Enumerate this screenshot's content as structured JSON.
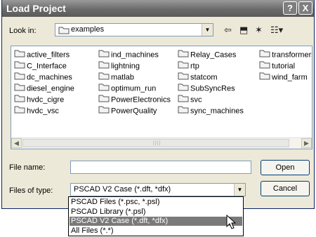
{
  "window": {
    "title": "Load Project",
    "help_glyph": "?",
    "close_glyph": "X"
  },
  "lookin": {
    "label": "Look in:",
    "value": "examples"
  },
  "toolbar": [
    {
      "name": "back-icon",
      "glyph": "⇦"
    },
    {
      "name": "up-folder-icon",
      "glyph": "⬒"
    },
    {
      "name": "new-folder-icon",
      "glyph": "✶"
    },
    {
      "name": "view-menu-icon",
      "glyph": "☷▾"
    }
  ],
  "folders": [
    "active_filters",
    "C_Interface",
    "dc_machines",
    "diesel_engine",
    "hvdc_cigre",
    "hvdc_vsc",
    "ind_machines",
    "lightning",
    "matlab",
    "optimum_run",
    "PowerElectronics",
    "PowerQuality",
    "Relay_Cases",
    "rtp",
    "statcom",
    "SubSyncRes",
    "svc",
    "sync_machines",
    "transformers",
    "tutorial",
    "wind_farm"
  ],
  "file_name": {
    "label": "File name:",
    "value": ""
  },
  "file_type": {
    "label": "Files of type:",
    "value": "PSCAD V2 Case (*.dft, *dfx)",
    "options": [
      "PSCAD Files (*.psc, *.psl)",
      "PSCAD Library (*.psl)",
      "PSCAD V2 Case (*.dft, *dfx)",
      "All Files (*.*)"
    ],
    "selected_index": 2
  },
  "buttons": {
    "open": "Open",
    "cancel": "Cancel"
  }
}
